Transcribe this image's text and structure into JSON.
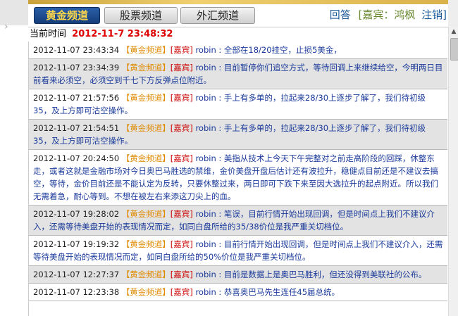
{
  "tabs": [
    {
      "label": "黄金频道",
      "active": true
    },
    {
      "label": "股票频道",
      "active": false
    },
    {
      "label": "外汇频道",
      "active": false
    }
  ],
  "toplinks": {
    "reply": "回答",
    "guest": "[嘉宾：鸿枫",
    "logout": "注销]"
  },
  "timebar": {
    "label": "当前时间",
    "value": "2012-11-7 23:48:32"
  },
  "messages": [
    {
      "time": "2012-11-07 23:43:34",
      "channel": "【黄金频道】",
      "role": "[嘉宾]",
      "user": "robin",
      "text": " : 全部在18/20挂空，止损5美金，"
    },
    {
      "time": "2012-11-07 23:34:39",
      "channel": "【黄金频道】",
      "role": "[嘉宾]",
      "user": "robin",
      "text": " : 目前暂停你们追空方式，等待回调上来继续给空，今明两日目前看来必须空，必须空到千七下方反弹点位附近。"
    },
    {
      "time": "2012-11-07 21:57:56",
      "channel": "【黄金频道】",
      "role": "[嘉宾]",
      "user": "robin",
      "text": " : 手上有多单的，拉起来28/30上逐步了解了，我们待初级35，及上方即可沽空操作。"
    },
    {
      "time": "2012-11-07 21:54:51",
      "channel": "【黄金频道】",
      "role": "[嘉宾]",
      "user": "robin",
      "text": " : 手上有多单的，拉起来28/30上逐步了解了，我们待初级35，及上方即可沽空操作。"
    },
    {
      "time": "2012-11-07 20:24:50",
      "channel": "【黄金频道】",
      "role": "[嘉宾]",
      "user": "robin",
      "text": " : 美指从技术上今天下午完整对之前走高阶段的回踩，休整东走，或者这就是金融市场对今日奥巴马胜选的禁维，金价美盘开盘后估计还有波拉升，稳健点目前还是不建议去搞空，等待，金价目前还是不能认定为反转，只要休整过来，两日即可下跌下来至因大选拉升的起点附近。所以我们无需着急，耐心等到。不想在被左右来添这刀尖上的血。"
    },
    {
      "time": "2012-11-07 19:28:02",
      "channel": "【黄金频道】",
      "role": "[嘉宾]",
      "user": "robin",
      "text": " : 笔误，目前行情开始出现回调，但是时间点上我们不建议介入，还需等待美盘开始的表现情况而定，如同白盘所给的35/38价位是我严重关切档位。"
    },
    {
      "time": "2012-11-07 19:19:32",
      "channel": "【黄金频道】",
      "role": "[嘉宾]",
      "user": "robin",
      "text": " : 目前行情开始出现回调，但是时间点上我们不建议介入，还需等待美盘开始的表现情况而定，如同白盘所给的50%价位是我严重关切档位。"
    },
    {
      "time": "2012-11-07 12:27:37",
      "channel": "【黄金频道】",
      "role": "[嘉宾]",
      "user": "robin",
      "text": " : 目前是数据上是奥巴马胜利，但还没得到美联社的公布。"
    },
    {
      "time": "2012-11-07 12:23:38",
      "channel": "【黄金频道】",
      "role": "[嘉宾]",
      "user": "robin",
      "text": " : 恭喜奥巴马先生连任45届总统。"
    }
  ]
}
